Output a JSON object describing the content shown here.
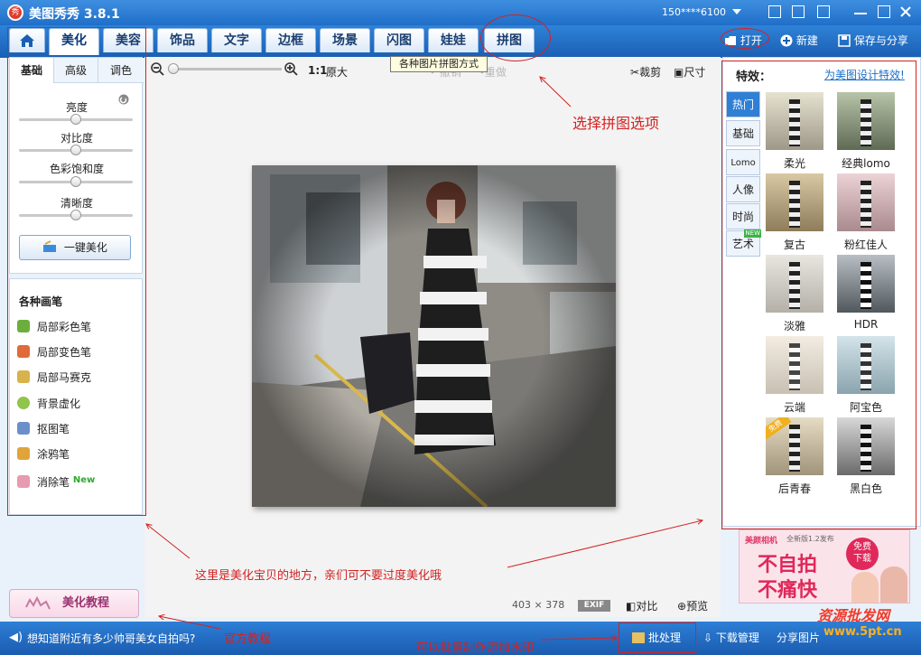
{
  "app": {
    "title": "美图秀秀 3.8.1",
    "account": "150****6100",
    "logo_glyph": "秀"
  },
  "nav_tabs": [
    {
      "label": "美化",
      "active": true
    },
    {
      "label": "美容"
    },
    {
      "label": "饰品"
    },
    {
      "label": "文字"
    },
    {
      "label": "边框"
    },
    {
      "label": "场景"
    },
    {
      "label": "闪图"
    },
    {
      "label": "娃娃"
    },
    {
      "label": "拼图"
    }
  ],
  "top_actions": {
    "open": "打开",
    "new": "新建",
    "save": "保存与分享"
  },
  "left_panel": {
    "subtabs": [
      "基础",
      "高级",
      "调色"
    ],
    "sliders": [
      {
        "label": "亮度",
        "value": 0.5
      },
      {
        "label": "对比度",
        "value": 0.5
      },
      {
        "label": "色彩饱和度",
        "value": 0.5
      },
      {
        "label": "清晰度",
        "value": 0.5
      }
    ],
    "one_key_button": "一键美化",
    "brush_title": "各种画笔",
    "brushes": [
      {
        "label": "局部彩色笔",
        "color": "#6cae3c"
      },
      {
        "label": "局部变色笔",
        "color": "#e06a3a"
      },
      {
        "label": "局部马赛克",
        "color": "#d8b24a"
      },
      {
        "label": "背景虚化",
        "color": "#8fc54a"
      },
      {
        "label": "抠图笔",
        "color": "#6b8fc9"
      },
      {
        "label": "涂鸦笔",
        "color": "#e0a43a"
      },
      {
        "label": "消除笔",
        "color": "#e79ab0",
        "badge": "New"
      }
    ],
    "tutorial_button": "美化教程"
  },
  "canvas": {
    "ratio_label": "1:1",
    "original_label": "原大",
    "undo": "撤销",
    "redo": "重做",
    "crop": "裁剪",
    "size": "尺寸",
    "tooltip": "各种图片拼图方式",
    "dim_w": "403",
    "dim_x": "×",
    "dim_h": "378",
    "exif": "EXIF",
    "compare": "对比",
    "preview": "预览"
  },
  "right_panel": {
    "title": "特效：",
    "link": "为美图设计特效!",
    "categories": [
      "热门",
      "基础",
      "Lomo",
      "人像",
      "时尚",
      "艺术"
    ],
    "new_badge": "NEW",
    "effects": [
      "柔光",
      "经典lomo",
      "复古",
      "粉红佳人",
      "淡雅",
      "HDR",
      "云端",
      "阿宝色",
      "后青春",
      "黑白色"
    ],
    "corner_badge": "免费"
  },
  "ad": {
    "brand": "美颜相机",
    "version": "全新版1.2发布",
    "slogan1": "不自拍",
    "slogan2": "不痛快",
    "free": "免费",
    "download": "下载"
  },
  "status": {
    "news": "想知道附近有多少帅哥美女自拍吗?",
    "batch": "批处理",
    "download_mgr": "下载管理",
    "share": "分享图片"
  },
  "annotations": {
    "puzzle": "选择拼图选项",
    "beautify": "这里是美化宝贝的地方，亲们可不要过度美化哦",
    "tutorial": "官方教程",
    "batch": "可以批量制作添加水印",
    "watermark": "资源批发网",
    "watermark_site": "www.5pt.cn"
  }
}
